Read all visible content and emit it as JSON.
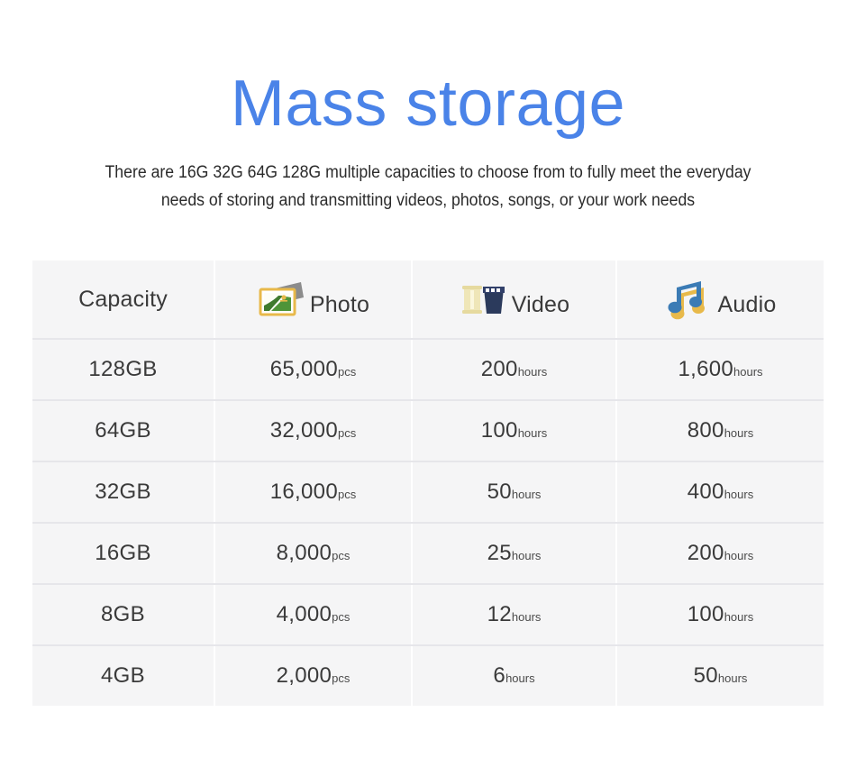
{
  "header": {
    "title": "Mass storage",
    "title_color": "#4a83e8",
    "subtitle_line1": "There are 16G 32G 64G 128G multiple capacities to choose from to fully meet the everyday",
    "subtitle_line2": "needs of storing and transmitting videos, photos, songs, or your work needs"
  },
  "table": {
    "columns": [
      {
        "label": "Capacity",
        "icon": null
      },
      {
        "label": "Photo",
        "icon": "photo-frame-icon"
      },
      {
        "label": "Video",
        "icon": "film-roll-icon"
      },
      {
        "label": "Audio",
        "icon": "music-note-icon"
      }
    ],
    "rows": [
      {
        "capacity": "128GB",
        "photo_value": "65,000",
        "photo_unit": "pcs",
        "video_value": "200",
        "video_unit": "hours",
        "audio_value": "1,600",
        "audio_unit": "hours"
      },
      {
        "capacity": "64GB",
        "photo_value": "32,000",
        "photo_unit": "pcs",
        "video_value": "100",
        "video_unit": "hours",
        "audio_value": "800",
        "audio_unit": "hours"
      },
      {
        "capacity": "32GB",
        "photo_value": "16,000",
        "photo_unit": "pcs",
        "video_value": "50",
        "video_unit": "hours",
        "audio_value": "400",
        "audio_unit": "hours"
      },
      {
        "capacity": "16GB",
        "photo_value": "8,000",
        "photo_unit": "pcs",
        "video_value": "25",
        "video_unit": "hours",
        "audio_value": "200",
        "audio_unit": "hours"
      },
      {
        "capacity": "8GB",
        "photo_value": "4,000",
        "photo_unit": "pcs",
        "video_value": "12",
        "video_unit": "hours",
        "audio_value": "100",
        "audio_unit": "hours"
      },
      {
        "capacity": "4GB",
        "photo_value": "2,000",
        "photo_unit": "pcs",
        "video_value": "6",
        "video_unit": "hours",
        "audio_value": "50",
        "audio_unit": "hours"
      }
    ]
  },
  "colors": {
    "accent_blue": "#4a83e8",
    "cell_background": "#f5f5f6",
    "row_divider": "#e6e6ea",
    "page_background": "#ffffff",
    "photo_frame": "#e8b94a",
    "photo_landscape": "#3f7a2e",
    "video_spool": "#efe6b8",
    "video_canister": "#2b3a5c",
    "audio_note": "#3b7bb5",
    "audio_shadow": "#e8b94a"
  }
}
